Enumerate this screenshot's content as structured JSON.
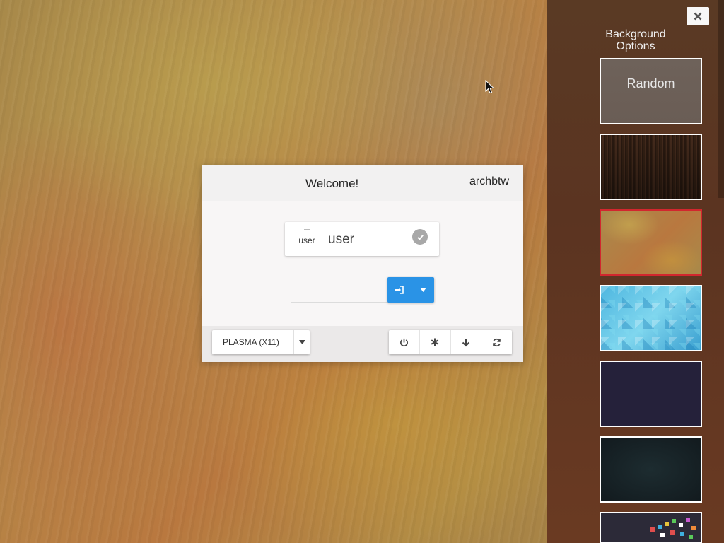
{
  "login": {
    "welcome_text": "Welcome!",
    "hostname": "archbtw",
    "user": {
      "avatar_text": "user",
      "name": "user"
    },
    "session": {
      "selected": "PLASMA (X11)"
    }
  },
  "background_options": {
    "title": "Background Options",
    "random_label": "Random",
    "selected_index": 2
  },
  "colors": {
    "accent": "#2a93e6",
    "selected_border": "#d2262e",
    "panel_bg": "#5b3421"
  }
}
